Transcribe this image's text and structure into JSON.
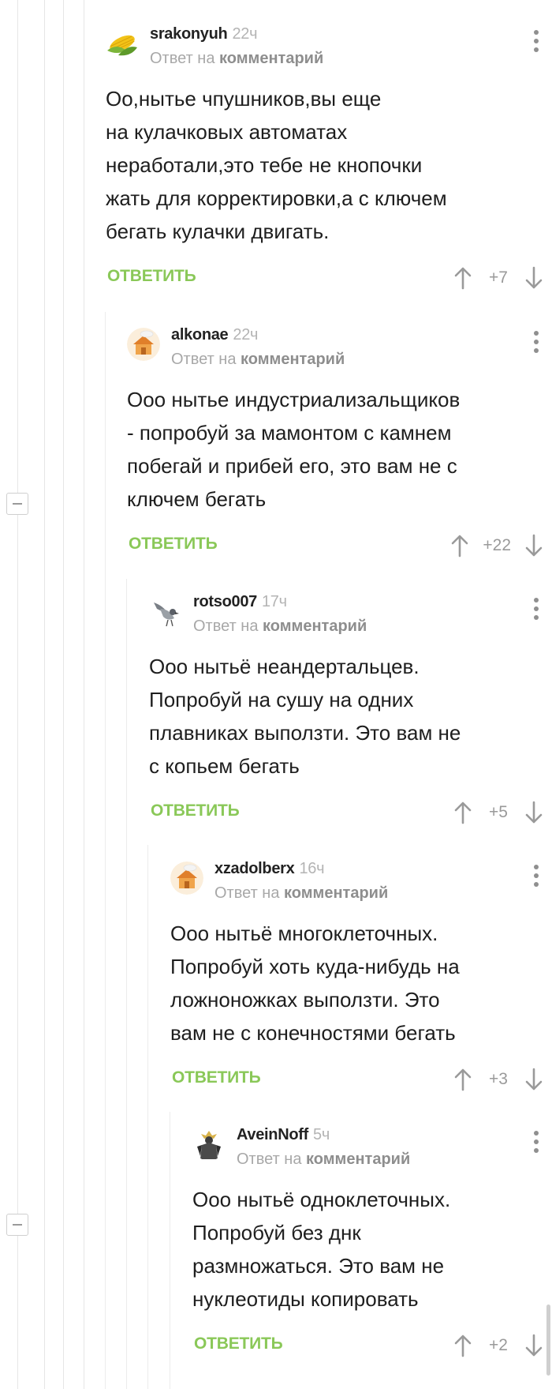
{
  "comments": [
    {
      "author": "srakonyuh",
      "time": "22ч",
      "reply_prefix": "Ответ на",
      "reply_target": "комментарий",
      "text": "Оо,нытье чпушников,вы еще\nна кулачковых автоматах\nнеработали,это тебе не кнопочки\nжать для корректировки,а с ключем\nбегать кулачки двигать.",
      "reply_label": "ОТВЕТИТЬ",
      "score": "+7",
      "avatar_icon": "corn-avatar-icon"
    },
    {
      "author": "alkonae",
      "time": "22ч",
      "reply_prefix": "Ответ на",
      "reply_target": "комментарий",
      "text": "Ооо нытье индустриализальщиков\n- попробуй за мамонтом с камнем\nпобегай и прибей его, это вам не с\nключем бегать",
      "reply_label": "ОТВЕТИТЬ",
      "score": "+22",
      "avatar_icon": "house-avatar-icon"
    },
    {
      "author": "rotso007",
      "time": "17ч",
      "reply_prefix": "Ответ на",
      "reply_target": "комментарий",
      "text": "Ооо нытьё неандертальцев.\nПопробуй на сушу на одних\nплавниках выползти. Это вам не\nс копьем бегать",
      "reply_label": "ОТВЕТИТЬ",
      "score": "+5",
      "avatar_icon": "bird-avatar-icon"
    },
    {
      "author": "xzadolberx",
      "time": "16ч",
      "reply_prefix": "Ответ на",
      "reply_target": "комментарий",
      "text": "Ооо нытьё многоклеточных.\nПопробуй хоть куда-нибудь на\nложноножках выползти. Это\nвам не с конечностями бегать",
      "reply_label": "ОТВЕТИТЬ",
      "score": "+3",
      "avatar_icon": "house-avatar-icon"
    },
    {
      "author": "AveinNoff",
      "time": "5ч",
      "reply_prefix": "Ответ на",
      "reply_target": "комментарий",
      "text": "Ооо нытьё одноклеточных.\nПопробуй без днк\nразмножаться. Это вам не\nнуклеотиды копировать",
      "reply_label": "ОТВЕТИТЬ",
      "score": "+2",
      "avatar_icon": "knight-avatar-icon"
    }
  ],
  "colors": {
    "reply_green": "#8ac858",
    "thread_line": "#e6e6e6",
    "muted_text": "#a8a8a8"
  }
}
